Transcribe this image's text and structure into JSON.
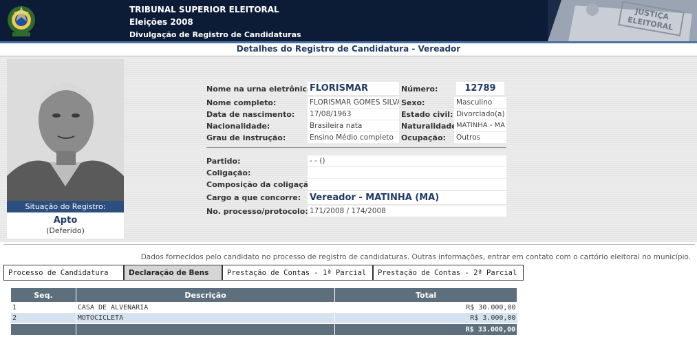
{
  "header": {
    "line1": "TRIBUNAL SUPERIOR ELEITORAL",
    "line2": "Eleições 2008",
    "line3": "Divulgação de Registro de Candidaturas",
    "stamp_text": "JUSTIÇA ELEITORAL"
  },
  "page_title": "Detalhes do Registro de Candidatura - Vereador",
  "situacao": {
    "label": "Situação do Registro:",
    "status": "Apto",
    "detail": "(Deferido)"
  },
  "candidate": {
    "urna_label": "Nome na urna eletrônica:",
    "urna_value": "FLORISMAR",
    "numero_label": "Número:",
    "numero_value": "12789",
    "nome_label": "Nome completo:",
    "nome_value": "FLORISMAR GOMES SILVA",
    "sexo_label": "Sexo:",
    "sexo_value": "Masculino",
    "nasc_label": "Data de nascimento:",
    "nasc_value": "17/08/1963",
    "civil_label": "Estado civil:",
    "civil_value": "Divorciado(a)",
    "nac_label": "Nacionalidade:",
    "nac_value": "Brasileira nata",
    "natural_label": "Naturalidade:",
    "natural_value": "MATINHA - MA",
    "grau_label": "Grau de instrução:",
    "grau_value": "Ensino Médio completo",
    "ocup_label": "Ocupação:",
    "ocup_value": "Outros",
    "partido_label": "Partido:",
    "partido_value": "- - ()",
    "coligacao_label": "Coligação:",
    "coligacao_value": "",
    "composicao_label": "Composição da coligação:",
    "composicao_value": "",
    "cargo_label": "Cargo a que concorre:",
    "cargo_value": "Vereador - MATINHA (MA)",
    "processo_label": "No. processo/protocolo:",
    "processo_value": "171/2008 / 174/2008"
  },
  "note": "Dados fornecidos pelo candidato no processo de registro de candidaturas. Outras informações, entrar em contato com o cartório eleitoral no município.",
  "tabs": [
    {
      "label": "Processo de Candidatura"
    },
    {
      "label": "Declaração de Bens"
    },
    {
      "label": "Prestação de Contas - 1ª Parcial"
    },
    {
      "label": "Prestação de Contas - 2ª Parcial"
    }
  ],
  "bens": {
    "headers": [
      "Seq.",
      "Descrição",
      "Total"
    ],
    "rows": [
      {
        "seq": "1",
        "desc": "CASA DE ALVENARIA",
        "total": "R$ 30.000,00"
      },
      {
        "seq": "2",
        "desc": "MOTOCICLETA",
        "total": "R$ 3.000,00"
      }
    ],
    "grand_total": "R$ 33.000,00"
  },
  "colors": {
    "header_bg": "#0c1c37",
    "accent_blue": "#1f3a66",
    "table_header": "#5d6f7d",
    "row_alt": "#d4e3ef"
  }
}
